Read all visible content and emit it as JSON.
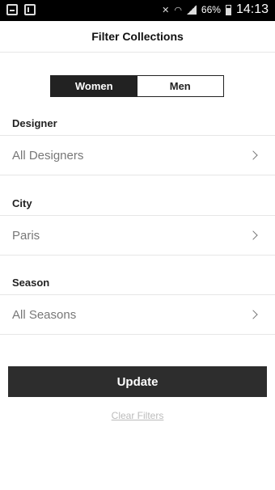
{
  "status_bar": {
    "left_icons": [
      "gallery-icon",
      "document-icon"
    ],
    "right_icons": [
      "mute-icon",
      "wifi-icon",
      "signal-icon",
      "battery-icon"
    ],
    "battery_percent": "66%",
    "time": "14:13"
  },
  "header": {
    "title": "Filter Collections"
  },
  "gender_toggle": {
    "options": [
      "Women",
      "Men"
    ],
    "selected": "Women"
  },
  "filters": [
    {
      "label": "Designer",
      "value": "All Designers"
    },
    {
      "label": "City",
      "value": "Paris"
    },
    {
      "label": "Season",
      "value": "All Seasons"
    }
  ],
  "actions": {
    "update_label": "Update",
    "clear_label": "Clear Filters"
  },
  "colors": {
    "primary_dark": "#2d2d2d",
    "text": "#222222",
    "muted": "#777777",
    "divider": "#e6e6e6"
  }
}
